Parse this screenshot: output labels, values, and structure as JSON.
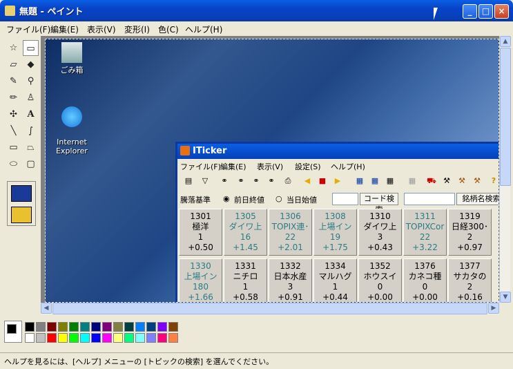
{
  "window": {
    "title": "無題 - ペイント",
    "icon": "paint-icon"
  },
  "menu": [
    "ファイル(F)",
    "編集(E)",
    "表示(V)",
    "変形(I)",
    "色(C)",
    "ヘルプ(H)"
  ],
  "desktop": {
    "icons": [
      {
        "label": "ごみ箱",
        "icon": "recycle-bin-icon"
      },
      {
        "label": "Internet\nExplorer",
        "icon": "ie-icon"
      }
    ]
  },
  "iticker": {
    "title": "ITicker",
    "menu": [
      "ファイル(F)",
      "編集(E)",
      "表示(V)",
      "設定(S)",
      "ヘルプ(H)"
    ],
    "basis_label": "騰落基準",
    "radio1": "前日終値",
    "radio2": "当日始値",
    "code_search": "コード検索",
    "name_search": "銘柄名検索",
    "cells": [
      {
        "code": "1301",
        "name": "極洋",
        "count": "1",
        "change": "+0.50",
        "teal": false
      },
      {
        "code": "1305",
        "name": "ダイワ上",
        "count": "16",
        "change": "+1.45",
        "teal": true
      },
      {
        "code": "1306",
        "name": "TOPIX連･",
        "count": "22",
        "change": "+2.01",
        "teal": true
      },
      {
        "code": "1308",
        "name": "上場イン",
        "count": "19",
        "change": "+1.75",
        "teal": true
      },
      {
        "code": "1310",
        "name": "ダイワ上",
        "count": "3",
        "change": "+0.43",
        "teal": false
      },
      {
        "code": "1311",
        "name": "TOPIXCor",
        "count": "22",
        "change": "+3.22",
        "teal": true
      },
      {
        "code": "1319",
        "name": "日経300･",
        "count": "2",
        "change": "+0.97",
        "teal": false
      },
      {
        "code": "1330",
        "name": "上場イン",
        "count": "180",
        "change": "+1.66",
        "teal": true
      },
      {
        "code": "1331",
        "name": "ニチロ",
        "count": "1",
        "change": "+0.58",
        "teal": false
      },
      {
        "code": "1332",
        "name": "日本水産",
        "count": "3",
        "change": "+0.91",
        "teal": false
      },
      {
        "code": "1334",
        "name": "マルハグ",
        "count": "1",
        "change": "+0.44",
        "teal": false
      },
      {
        "code": "1352",
        "name": "ホウスイ",
        "count": "0",
        "change": "+0.00",
        "teal": false
      },
      {
        "code": "1376",
        "name": "カネコ種",
        "count": "0",
        "change": "+0.00",
        "teal": false
      },
      {
        "code": "1377",
        "name": "サカタの",
        "count": "2",
        "change": "+0.16",
        "teal": false
      }
    ]
  },
  "palette": [
    "#000000",
    "#808080",
    "#800000",
    "#808000",
    "#008000",
    "#008080",
    "#000080",
    "#800080",
    "#808040",
    "#004040",
    "#0080ff",
    "#004080",
    "#8000ff",
    "#804000",
    "#ffffff",
    "#c0c0c0",
    "#ff0000",
    "#ffff00",
    "#00ff00",
    "#00ffff",
    "#0000ff",
    "#ff00ff",
    "#ffff80",
    "#00ff80",
    "#80ffff",
    "#8080ff",
    "#ff0080",
    "#ff8040"
  ],
  "status": "ヘルプを見るには、[ヘルプ] メニューの [トピックの検索] を選んでください。"
}
